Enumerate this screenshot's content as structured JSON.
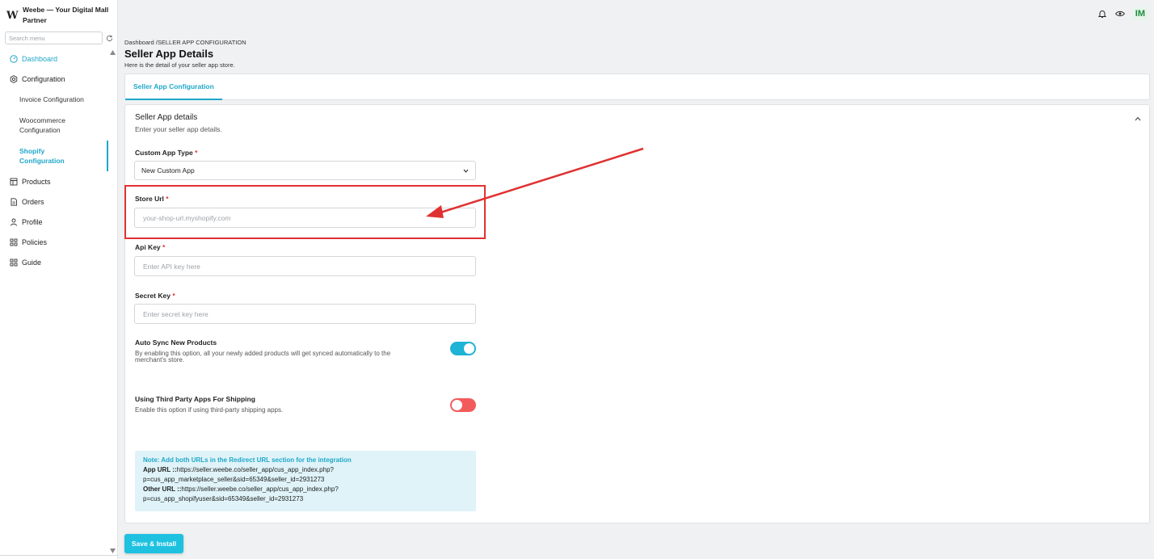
{
  "brand": {
    "logo": "W",
    "name": "Weebe — Your Digital Mall Partner"
  },
  "search": {
    "placeholder": "Search menu"
  },
  "sidebar": {
    "items": [
      {
        "label": "Dashboard",
        "icon": "dashboard-icon",
        "active": true
      },
      {
        "label": "Configuration",
        "icon": "gear-icon"
      },
      {
        "label": "Invoice Configuration"
      },
      {
        "label": "Woocommerce Configuration"
      },
      {
        "label": "Shopify Configuration",
        "active": true
      },
      {
        "label": "Products",
        "icon": "products-icon"
      },
      {
        "label": "Orders",
        "icon": "orders-icon"
      },
      {
        "label": "Profile",
        "icon": "user-icon"
      },
      {
        "label": "Policies",
        "icon": "grid-icon"
      },
      {
        "label": "Guide",
        "icon": "grid-icon"
      }
    ]
  },
  "topbar": {
    "avatar": "IM"
  },
  "header": {
    "breadcrumb": "Dashboard /SELLER APP CONFIGURATION",
    "title": "Seller App Details",
    "subtitle": "Here is the detail of your seller app store."
  },
  "tabs": [
    {
      "label": "Seller App Configuration"
    }
  ],
  "form": {
    "section_title": "Seller App details",
    "section_subtitle": "Enter your seller app details.",
    "app_type": {
      "label": "Custom App Type",
      "value": "New Custom App"
    },
    "store_url": {
      "label": "Store Url",
      "placeholder": "your-shop-url.myshopify.com"
    },
    "api_key": {
      "label": "Api Key",
      "placeholder": "Enter API key here"
    },
    "secret_key": {
      "label": "Secret Key",
      "placeholder": "Enter secret key here"
    },
    "required_mark": "*",
    "auto_sync": {
      "title": "Auto Sync New Products",
      "desc": "By enabling this option, all your newly added products will get synced automatically to the merchant's store.",
      "enabled": true
    },
    "third_party": {
      "title": "Using Third Party Apps For Shipping",
      "desc": "Enable this option if using third-party shipping apps.",
      "enabled": false
    },
    "note": {
      "heading": "Note: Add both URLs in the Redirect URL section for the integration",
      "app_url_label": "App URL ::",
      "app_url_value": "https://seller.weebe.co/seller_app/cus_app_index.php?",
      "app_url_query": "p=cus_app_marketplace_seller&sid=65349&seller_id=2931273",
      "other_url_label": "Other URL ::",
      "other_url_value": "https://seller.weebe.co/seller_app/cus_app_index.php?",
      "other_url_query": "p=cus_app_shopifyuser&sid=65349&seller_id=2931273"
    }
  },
  "actions": {
    "save_label": "Save & Install"
  },
  "colors": {
    "accent": "#1fa7c9",
    "toggle_on": "#1fb3d6",
    "toggle_off": "#f25b5b",
    "annotation": "#e03131"
  }
}
